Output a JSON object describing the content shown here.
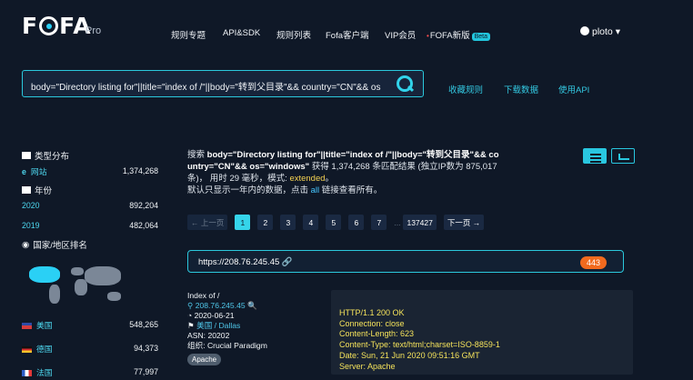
{
  "header": {
    "logo": "FOFA",
    "pro": "Pro",
    "nav": [
      "规则专题",
      "API&SDK",
      "规则列表",
      "Fofa客户端",
      "VIP会员",
      "FOFA新版"
    ],
    "beta": "Beta",
    "user": "ploto"
  },
  "search": {
    "query": "body=\"Directory listing for\"||title=\"index of /\"||body=\"转到父目录\"&& country=\"CN\"&& os=\"windows\"",
    "actions": [
      "收藏规则",
      "下载数据",
      "使用API"
    ]
  },
  "sidebar": {
    "sections": [
      {
        "title": "类型分布",
        "rows": [
          {
            "label": "网站",
            "value": "1,374,268"
          }
        ]
      },
      {
        "title": "年份",
        "rows": [
          {
            "label": "2020",
            "value": "892,204"
          },
          {
            "label": "2019",
            "value": "482,064"
          }
        ]
      },
      {
        "title": "国家/地区排名",
        "rows": [
          {
            "label": "美国",
            "value": "548,265"
          },
          {
            "label": "德国",
            "value": "94,373"
          },
          {
            "label": "法国",
            "value": "77,997"
          }
        ]
      }
    ]
  },
  "result": {
    "line1_prefix": "搜索",
    "line1_query": " body=\"Directory listing for\"||title=\"index of /\"||body=\"转到父目录\"&& co",
    "line2_query": "untry=\"CN\"&& os=\"windows\"",
    "line2_suffix": " 获得 1,374,268 条匹配结果 (独立IP数为 875,017",
    "line3a": "条)， 用时 29 毫秒，模式: ",
    "line3b": "extended",
    "line3c": "。",
    "line4a": "默认只显示一年内的数据，点击 ",
    "line4b": "all",
    "line4c": " 链接查看所有。",
    "pager": [
      "← 上一页",
      "1",
      "2",
      "3",
      "4",
      "5",
      "6",
      "7",
      "...",
      "137427",
      "下一页 →"
    ],
    "url": "https://208.76.245.45",
    "badge": "443",
    "meta": [
      "Index of /",
      "208.76.245.45",
      "2020-06-21",
      "美国 / Dallas",
      "ASN: 20202",
      "组织: Crucial Paradigm",
      "Apache"
    ],
    "http": [
      "HTTP/1.1 200 OK",
      "Connection: close",
      "Content-Length: 623",
      "Content-Type: text/html;charset=ISO-8859-1",
      "Date: Sun, 21 Jun 2020 09:51:16 GMT",
      "Server: Apache"
    ]
  }
}
